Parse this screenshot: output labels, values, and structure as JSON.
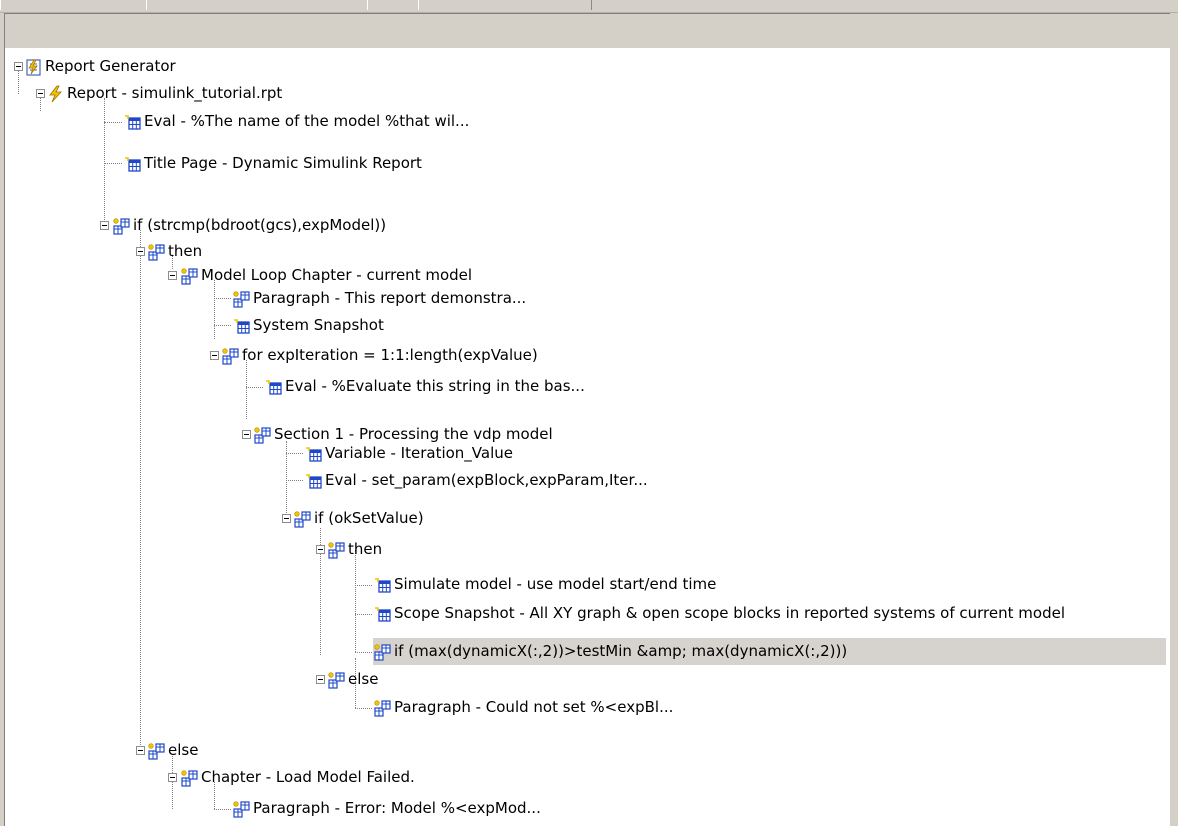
{
  "tree": {
    "root": {
      "label": "Report Generator",
      "icon": "report-generator-icon"
    },
    "report": {
      "label": "Report - simulink_tutorial.rpt",
      "icon": "lightning-report-icon"
    },
    "eval_model_name": {
      "label": "Eval - %The name of the model %that wil...",
      "icon": "component-table-icon"
    },
    "title_page": {
      "label": "Title Page - Dynamic Simulink Report",
      "icon": "component-table-icon"
    },
    "if_strcmp": {
      "label": "if (strcmp(bdroot(gcs),expModel))",
      "icon": "component-branch-icon"
    },
    "then_1": {
      "label": "then",
      "icon": "component-branch-icon"
    },
    "model_loop": {
      "label": "Model Loop Chapter - current model",
      "icon": "component-branch-icon"
    },
    "paragraph_demo": {
      "label": "Paragraph - This report demonstra...",
      "icon": "component-branch-icon"
    },
    "system_snapshot": {
      "label": "System Snapshot",
      "icon": "component-table-icon"
    },
    "for_loop": {
      "label": "for expIteration = 1:1:length(expValue)",
      "icon": "component-branch-icon"
    },
    "eval_evaluate": {
      "label": "Eval - %Evaluate this string in the bas...",
      "icon": "component-table-icon"
    },
    "section_1": {
      "label": "Section 1 - Processing the vdp model",
      "icon": "component-branch-icon"
    },
    "variable": {
      "label": "Variable - Iteration_Value",
      "icon": "component-table-icon"
    },
    "eval_set_param": {
      "label": "Eval - set_param(expBlock,expParam,Iter...",
      "icon": "component-table-icon"
    },
    "if_ok": {
      "label": "if (okSetValue)",
      "icon": "component-branch-icon"
    },
    "then_2": {
      "label": "then",
      "icon": "component-branch-icon"
    },
    "simulate": {
      "label": "Simulate model - use model start/end time",
      "icon": "component-table-icon"
    },
    "scope_snapshot": {
      "label": "Scope Snapshot - All XY graph & open scope blocks in reported systems of current model",
      "icon": "component-table-icon"
    },
    "if_max": {
      "label": "if (max(dynamicX(:,2))>testMin &amp; max(dynamicX(:,2)))",
      "icon": "component-branch-icon",
      "selected": true
    },
    "else_1": {
      "label": "else",
      "icon": "component-branch-icon"
    },
    "paragraph_could_not": {
      "label": "Paragraph - Could not set %<expBl...",
      "icon": "component-branch-icon"
    },
    "else_2": {
      "label": "else",
      "icon": "component-branch-icon"
    },
    "chapter_load_failed": {
      "label": "Chapter - Load Model Failed.",
      "icon": "component-branch-icon"
    },
    "paragraph_error": {
      "label": "Paragraph - Error: Model %<expMod...",
      "icon": "component-branch-icon"
    }
  },
  "colors": {
    "selection": "#d6d3ce",
    "pane_background": "#ffffff",
    "chrome": "#d4d0c8",
    "icon_blue": "#1e48c8",
    "icon_yellow": "#f2c400"
  }
}
